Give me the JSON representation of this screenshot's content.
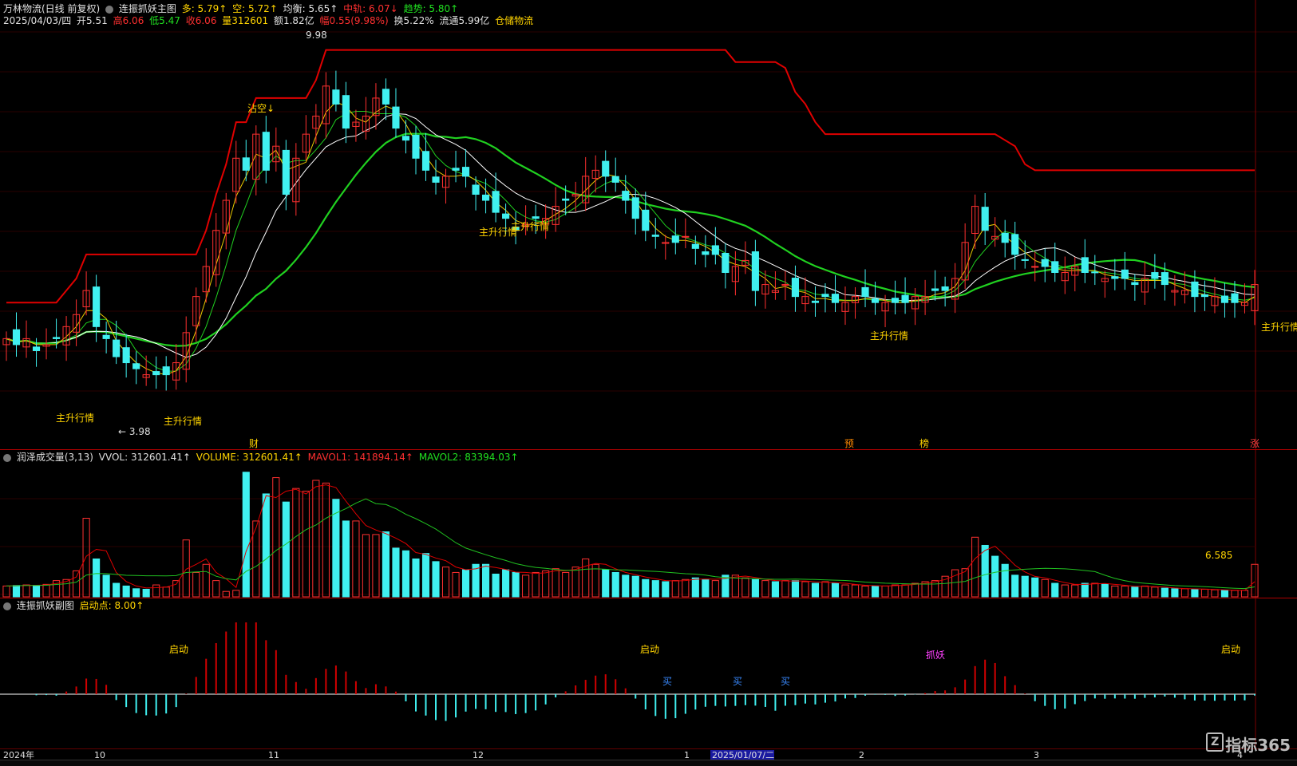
{
  "header": {
    "stock_name": "万林物流(日线 前复权)",
    "main_indicator": "连振抓妖主图",
    "duo": "多: 5.79↑",
    "kong": "空: 5.72↑",
    "junheng": "均衡: 5.65↑",
    "zhongshu": "中轨: 6.07↓",
    "qushi": "趋势: 5.80↑",
    "date": "2025/04/03/四",
    "open": "开5.51",
    "high": "高6.06",
    "low": "低5.47",
    "close": "收6.06",
    "vol": "量312601",
    "amount": "额1.82亿",
    "change": "幅0.55(9.98%)",
    "turnover": "换5.22%",
    "float": "流通5.99亿",
    "sector": "仓储物流"
  },
  "vol_header": {
    "name": "润泽成交量(3,13)",
    "vvol": "VVOL: 312601.41↑",
    "volume": "VOLUME: 312601.41↑",
    "mavol1": "MAVOL1: 141894.14↑",
    "mavol2": "MAVOL2: 83394.03↑"
  },
  "sub_header": {
    "name": "连振抓妖副图",
    "qidong": "启动点: 8.00↑"
  },
  "labels": {
    "price_high": "9.98",
    "price_low": "3.98",
    "zhukong": "沾空↓",
    "zhusheng": "主升行情",
    "cai": "财",
    "yu": "预",
    "bang": "榜",
    "zhang": "涨",
    "vol_right": "6.585",
    "qidong": "启动",
    "zhuayao": "抓妖",
    "mai": "买"
  },
  "date_axis": [
    "2024年",
    "10",
    "11",
    "12",
    "1",
    "2025/01/07/二",
    "2",
    "3",
    "4"
  ],
  "logo": "指标365",
  "colors": {
    "up": "#ff3030",
    "down": "#40f0f0",
    "ma_green": "#20d020",
    "ma_red": "#e00000",
    "ma_white": "#ffffff",
    "ma_yellow": "#e8c800"
  },
  "chart_data": {
    "type": "candlestick",
    "close": [
      5.2,
      5.1,
      5.2,
      5.0,
      5.1,
      5.2,
      5.4,
      5.6,
      6.0,
      5.4,
      5.2,
      4.9,
      4.8,
      4.7,
      4.6,
      4.6,
      4.6,
      4.8,
      5.3,
      5.9,
      6.4,
      7.0,
      7.5,
      8.2,
      8.0,
      8.6,
      8.0,
      8.4,
      7.6,
      8.2,
      8.6,
      8.9,
      9.4,
      9.1,
      8.7,
      8.8,
      8.9,
      9.2,
      9.1,
      8.7,
      8.5,
      8.2,
      8.0,
      7.8,
      7.9,
      8.0,
      7.9,
      7.6,
      7.5,
      7.3,
      7.2,
      7.0,
      7.1,
      7.2,
      7.2,
      7.4,
      7.5,
      7.6,
      7.9,
      8.0,
      7.9,
      7.8,
      7.5,
      7.2,
      7.0,
      6.9,
      6.8,
      6.8,
      6.9,
      6.7,
      6.6,
      6.6,
      6.3,
      6.4,
      6.5,
      6.0,
      6.1,
      6.0,
      6.1,
      5.9,
      5.9,
      5.8,
      5.9,
      5.8,
      5.8,
      5.9,
      5.9,
      5.8,
      5.8,
      5.8,
      5.8,
      5.9,
      5.9,
      6.0,
      6.0,
      6.2,
      6.8,
      7.4,
      7.0,
      6.9,
      6.8,
      6.6,
      6.5,
      6.4,
      6.4,
      6.3,
      6.3,
      6.4,
      6.3,
      6.3,
      6.2,
      6.2,
      6.2,
      6.1,
      6.2,
      6.2,
      6.1,
      6.0,
      6.0,
      5.9,
      5.9,
      5.9,
      5.8,
      5.8,
      5.8,
      6.1
    ],
    "volume": [
      20000,
      21000,
      22000,
      21000,
      23000,
      30000,
      32000,
      48000,
      145000,
      70000,
      40000,
      25000,
      20000,
      15000,
      14000,
      22000,
      18000,
      30000,
      105000,
      45000,
      60000,
      30000,
      10000,
      12000,
      230000,
      140000,
      190000,
      220000,
      175000,
      200000,
      195000,
      215000,
      210000,
      180000,
      140000,
      140000,
      115000,
      115000,
      120000,
      90000,
      85000,
      70000,
      80000,
      65000,
      55000,
      45000,
      50000,
      60000,
      60000,
      42000,
      50000,
      45000,
      40000,
      45000,
      48000,
      52000,
      45000,
      55000,
      70000,
      60000,
      50000,
      45000,
      40000,
      38000,
      32000,
      30000,
      28000,
      30000,
      32000,
      35000,
      32000,
      30000,
      40000,
      40000,
      35000,
      32000,
      30000,
      28000,
      30000,
      30000,
      28000,
      25000,
      28000,
      25000,
      22000,
      22000,
      20000,
      20000,
      20000,
      22000,
      22000,
      25000,
      28000,
      30000,
      38000,
      50000,
      52000,
      110000,
      95000,
      75000,
      60000,
      40000,
      38000,
      35000,
      32000,
      25000,
      22000,
      22000,
      25000,
      25000,
      24000,
      20000,
      20000,
      18000,
      20000,
      18000,
      16000,
      15000,
      15000,
      14000,
      14000,
      13000,
      12000,
      12000,
      12000,
      60000
    ]
  }
}
